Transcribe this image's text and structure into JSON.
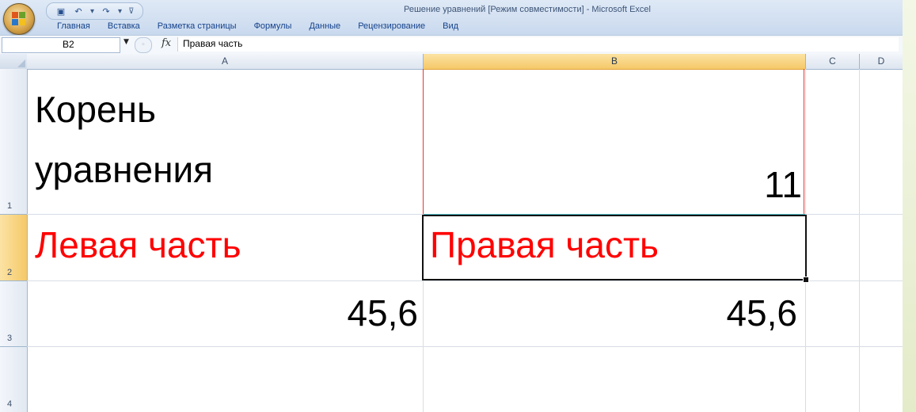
{
  "window": {
    "title": "Решение уравнений  [Режим совместимости] - Microsoft Excel"
  },
  "quick_access": {
    "icons": [
      "save-icon",
      "undo-icon",
      "redo-icon",
      "customize-icon"
    ],
    "save_glyph": "▣",
    "undo_glyph": "↶",
    "redo_glyph": "↷",
    "dropdown_glyph": "▾",
    "customize_glyph": "⊽"
  },
  "ribbon": {
    "tabs": [
      "Главная",
      "Вставка",
      "Разметка страницы",
      "Формулы",
      "Данные",
      "Рецензирование",
      "Вид"
    ]
  },
  "formula_bar": {
    "name_box": "B2",
    "fx_label": "fx",
    "content": "Правая часть"
  },
  "sheet": {
    "columns": [
      "A",
      "B",
      "C",
      "D"
    ],
    "selected_column": "B",
    "rows": [
      "1",
      "2",
      "3",
      "4"
    ],
    "selected_row": "2",
    "cells": {
      "A1_line1": "Корень",
      "A1_line2": "уравнения",
      "B1": "11",
      "A2": "Левая часть",
      "B2": "Правая часть",
      "A3": "45,6",
      "B3": "45,6"
    }
  },
  "colors": {
    "accent_text": "#ff0000",
    "selected_header": "#f5c868",
    "ribbon_tab_text": "#15428b"
  }
}
